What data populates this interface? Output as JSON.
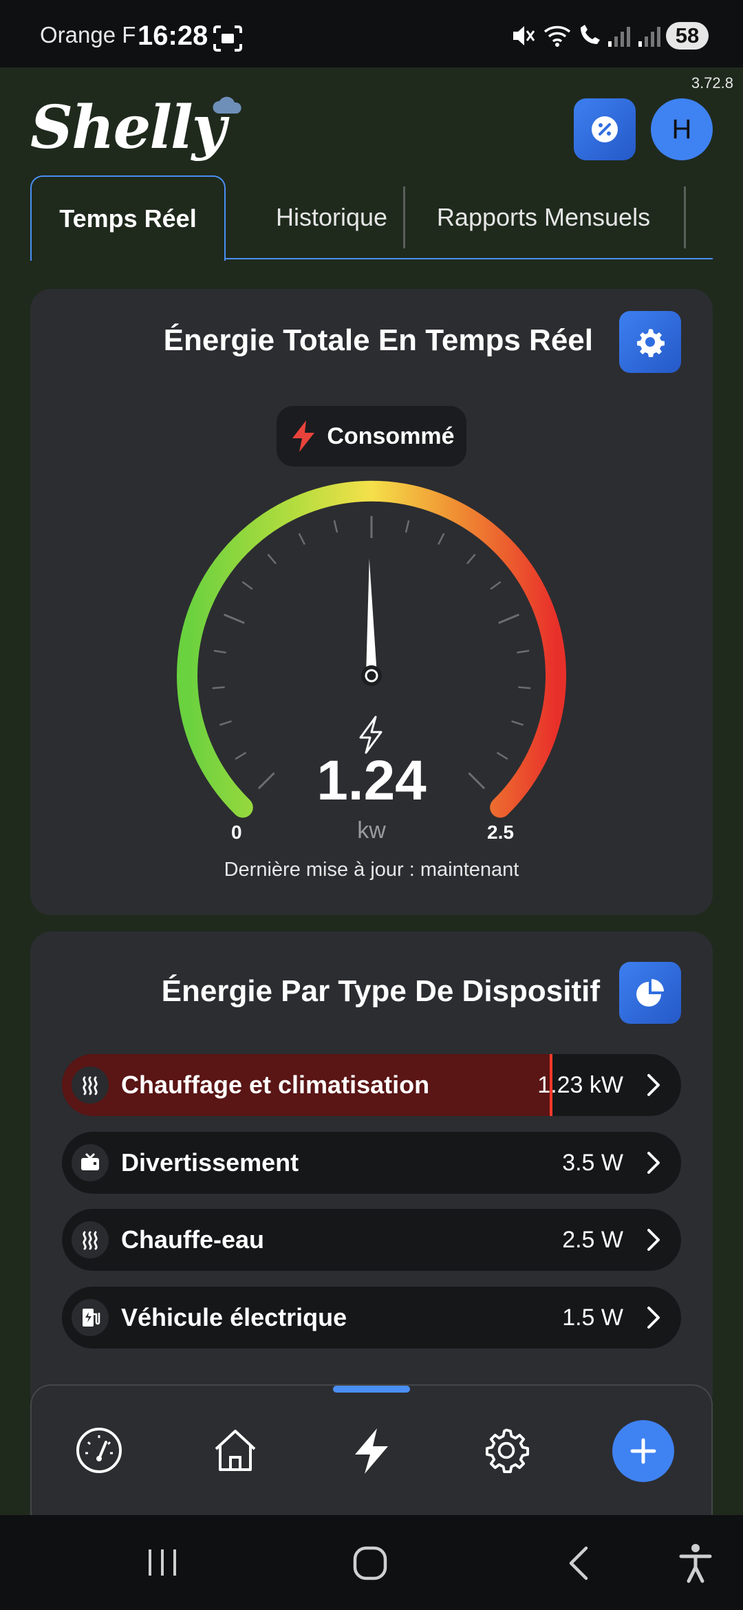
{
  "status_bar": {
    "carrier": "Orange F",
    "time": "16:28",
    "battery": "58"
  },
  "app": {
    "version": "3.72.8",
    "logo_text": "Shelly",
    "avatar_initial": "H"
  },
  "tabs": [
    {
      "label": "Temps Réel",
      "active": true
    },
    {
      "label": "Historique",
      "active": false
    },
    {
      "label": "Rapports Mensuels",
      "active": false
    }
  ],
  "realtime_card": {
    "title": "Énergie Totale En Temps Réel",
    "mode_label": "Consommé",
    "gauge": {
      "value": "1.24",
      "unit": "kw",
      "min": "0",
      "max": "2.5",
      "value_number": 1.24,
      "min_number": 0,
      "max_number": 2.5
    },
    "last_update": "Dernière mise à jour : maintenant"
  },
  "device_card": {
    "title": "Énergie Par Type De Dispositif",
    "rows": [
      {
        "label": "Chauffage et climatisation",
        "value": "1.23 kW",
        "icon": "heat-icon",
        "share": 0.79
      },
      {
        "label": "Divertissement",
        "value": "3.5 W",
        "icon": "tv-icon",
        "share": 0.0
      },
      {
        "label": "Chauffe-eau",
        "value": "2.5 W",
        "icon": "heat-icon",
        "share": 0.0
      },
      {
        "label": "Véhicule électrique",
        "value": "1.5 W",
        "icon": "ev-charger-icon",
        "share": 0.0
      }
    ]
  },
  "colors": {
    "accent": "#3f82f2",
    "gauge_green": "#6ad13f",
    "gauge_yellow": "#f5e04a",
    "gauge_red": "#e8302a"
  }
}
